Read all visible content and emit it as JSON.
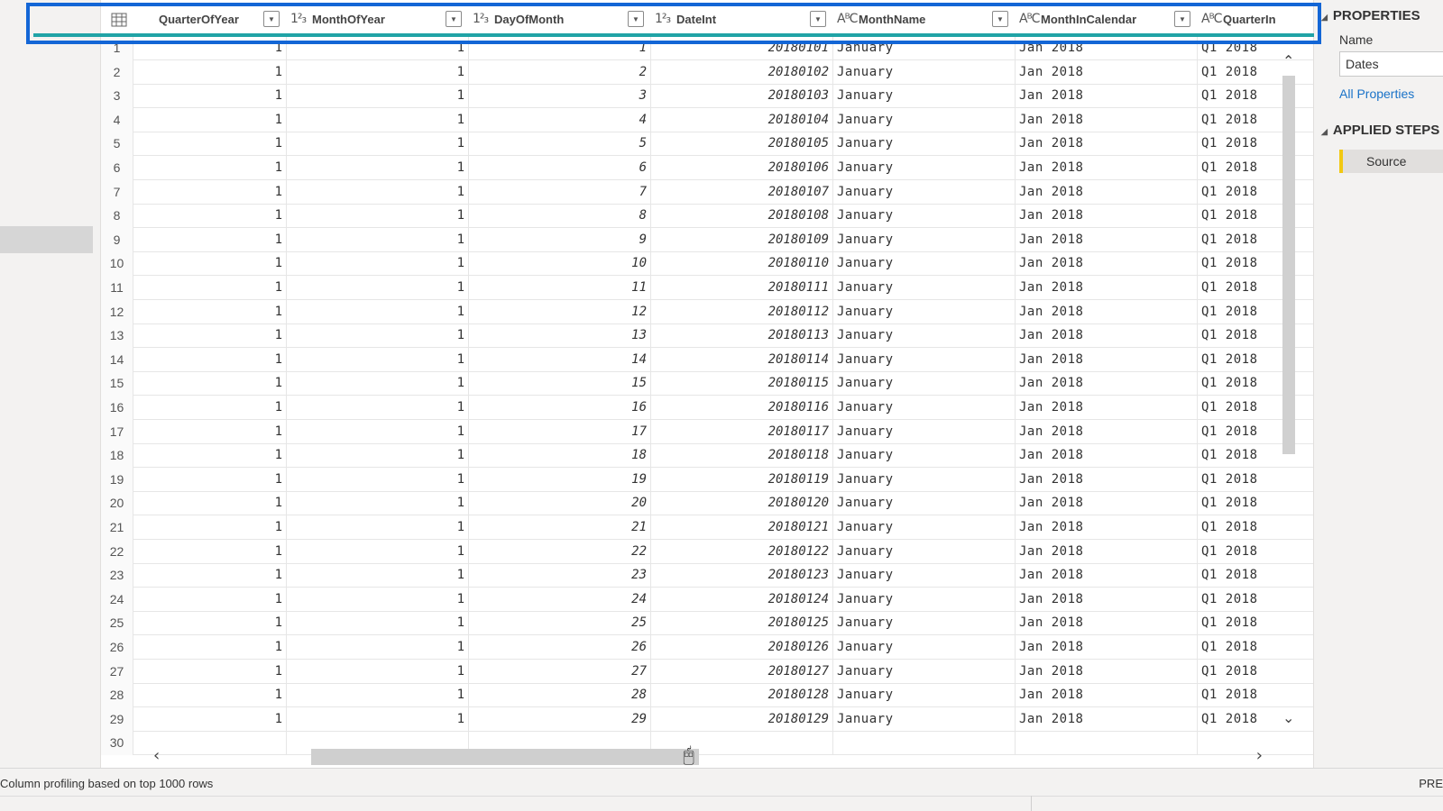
{
  "columns": [
    {
      "type": "",
      "name": "QuarterOfYear"
    },
    {
      "type": "1²₃",
      "name": "MonthOfYear"
    },
    {
      "type": "1²₃",
      "name": "DayOfMonth"
    },
    {
      "type": "1²₃",
      "name": "DateInt"
    },
    {
      "type": "AᴮC",
      "name": "MonthName"
    },
    {
      "type": "AᴮC",
      "name": "MonthInCalendar"
    },
    {
      "type": "AᴮC",
      "name": "QuarterIn"
    }
  ],
  "rows": [
    {
      "n": "1",
      "q": "1",
      "m": "1",
      "d": "1",
      "di": "20180101",
      "mn": "January",
      "mic": "Jan 2018",
      "qi": "Q1 2018"
    },
    {
      "n": "2",
      "q": "1",
      "m": "1",
      "d": "2",
      "di": "20180102",
      "mn": "January",
      "mic": "Jan 2018",
      "qi": "Q1 2018"
    },
    {
      "n": "3",
      "q": "1",
      "m": "1",
      "d": "3",
      "di": "20180103",
      "mn": "January",
      "mic": "Jan 2018",
      "qi": "Q1 2018"
    },
    {
      "n": "4",
      "q": "1",
      "m": "1",
      "d": "4",
      "di": "20180104",
      "mn": "January",
      "mic": "Jan 2018",
      "qi": "Q1 2018"
    },
    {
      "n": "5",
      "q": "1",
      "m": "1",
      "d": "5",
      "di": "20180105",
      "mn": "January",
      "mic": "Jan 2018",
      "qi": "Q1 2018"
    },
    {
      "n": "6",
      "q": "1",
      "m": "1",
      "d": "6",
      "di": "20180106",
      "mn": "January",
      "mic": "Jan 2018",
      "qi": "Q1 2018"
    },
    {
      "n": "7",
      "q": "1",
      "m": "1",
      "d": "7",
      "di": "20180107",
      "mn": "January",
      "mic": "Jan 2018",
      "qi": "Q1 2018"
    },
    {
      "n": "8",
      "q": "1",
      "m": "1",
      "d": "8",
      "di": "20180108",
      "mn": "January",
      "mic": "Jan 2018",
      "qi": "Q1 2018"
    },
    {
      "n": "9",
      "q": "1",
      "m": "1",
      "d": "9",
      "di": "20180109",
      "mn": "January",
      "mic": "Jan 2018",
      "qi": "Q1 2018"
    },
    {
      "n": "10",
      "q": "1",
      "m": "1",
      "d": "10",
      "di": "20180110",
      "mn": "January",
      "mic": "Jan 2018",
      "qi": "Q1 2018"
    },
    {
      "n": "11",
      "q": "1",
      "m": "1",
      "d": "11",
      "di": "20180111",
      "mn": "January",
      "mic": "Jan 2018",
      "qi": "Q1 2018"
    },
    {
      "n": "12",
      "q": "1",
      "m": "1",
      "d": "12",
      "di": "20180112",
      "mn": "January",
      "mic": "Jan 2018",
      "qi": "Q1 2018"
    },
    {
      "n": "13",
      "q": "1",
      "m": "1",
      "d": "13",
      "di": "20180113",
      "mn": "January",
      "mic": "Jan 2018",
      "qi": "Q1 2018"
    },
    {
      "n": "14",
      "q": "1",
      "m": "1",
      "d": "14",
      "di": "20180114",
      "mn": "January",
      "mic": "Jan 2018",
      "qi": "Q1 2018"
    },
    {
      "n": "15",
      "q": "1",
      "m": "1",
      "d": "15",
      "di": "20180115",
      "mn": "January",
      "mic": "Jan 2018",
      "qi": "Q1 2018"
    },
    {
      "n": "16",
      "q": "1",
      "m": "1",
      "d": "16",
      "di": "20180116",
      "mn": "January",
      "mic": "Jan 2018",
      "qi": "Q1 2018"
    },
    {
      "n": "17",
      "q": "1",
      "m": "1",
      "d": "17",
      "di": "20180117",
      "mn": "January",
      "mic": "Jan 2018",
      "qi": "Q1 2018"
    },
    {
      "n": "18",
      "q": "1",
      "m": "1",
      "d": "18",
      "di": "20180118",
      "mn": "January",
      "mic": "Jan 2018",
      "qi": "Q1 2018"
    },
    {
      "n": "19",
      "q": "1",
      "m": "1",
      "d": "19",
      "di": "20180119",
      "mn": "January",
      "mic": "Jan 2018",
      "qi": "Q1 2018"
    },
    {
      "n": "20",
      "q": "1",
      "m": "1",
      "d": "20",
      "di": "20180120",
      "mn": "January",
      "mic": "Jan 2018",
      "qi": "Q1 2018"
    },
    {
      "n": "21",
      "q": "1",
      "m": "1",
      "d": "21",
      "di": "20180121",
      "mn": "January",
      "mic": "Jan 2018",
      "qi": "Q1 2018"
    },
    {
      "n": "22",
      "q": "1",
      "m": "1",
      "d": "22",
      "di": "20180122",
      "mn": "January",
      "mic": "Jan 2018",
      "qi": "Q1 2018"
    },
    {
      "n": "23",
      "q": "1",
      "m": "1",
      "d": "23",
      "di": "20180123",
      "mn": "January",
      "mic": "Jan 2018",
      "qi": "Q1 2018"
    },
    {
      "n": "24",
      "q": "1",
      "m": "1",
      "d": "24",
      "di": "20180124",
      "mn": "January",
      "mic": "Jan 2018",
      "qi": "Q1 2018"
    },
    {
      "n": "25",
      "q": "1",
      "m": "1",
      "d": "25",
      "di": "20180125",
      "mn": "January",
      "mic": "Jan 2018",
      "qi": "Q1 2018"
    },
    {
      "n": "26",
      "q": "1",
      "m": "1",
      "d": "26",
      "di": "20180126",
      "mn": "January",
      "mic": "Jan 2018",
      "qi": "Q1 2018"
    },
    {
      "n": "27",
      "q": "1",
      "m": "1",
      "d": "27",
      "di": "20180127",
      "mn": "January",
      "mic": "Jan 2018",
      "qi": "Q1 2018"
    },
    {
      "n": "28",
      "q": "1",
      "m": "1",
      "d": "28",
      "di": "20180128",
      "mn": "January",
      "mic": "Jan 2018",
      "qi": "Q1 2018"
    },
    {
      "n": "29",
      "q": "1",
      "m": "1",
      "d": "29",
      "di": "20180129",
      "mn": "January",
      "mic": "Jan 2018",
      "qi": "Q1 2018"
    },
    {
      "n": "30",
      "q": "",
      "m": "",
      "d": "",
      "di": "",
      "mn": "",
      "mic": "",
      "qi": ""
    }
  ],
  "properties": {
    "heading": "PROPERTIES",
    "name_label": "Name",
    "name_value": "Dates",
    "all_properties": "All Properties"
  },
  "applied_steps": {
    "heading": "APPLIED STEPS",
    "steps": [
      "Source"
    ]
  },
  "status": {
    "profiling": "Column profiling based on top 1000 rows",
    "preview": "PRE"
  },
  "colors": {
    "highlight": "#1366d6",
    "quality_bar": "#20a3a6",
    "step_accent": "#f2c811"
  }
}
